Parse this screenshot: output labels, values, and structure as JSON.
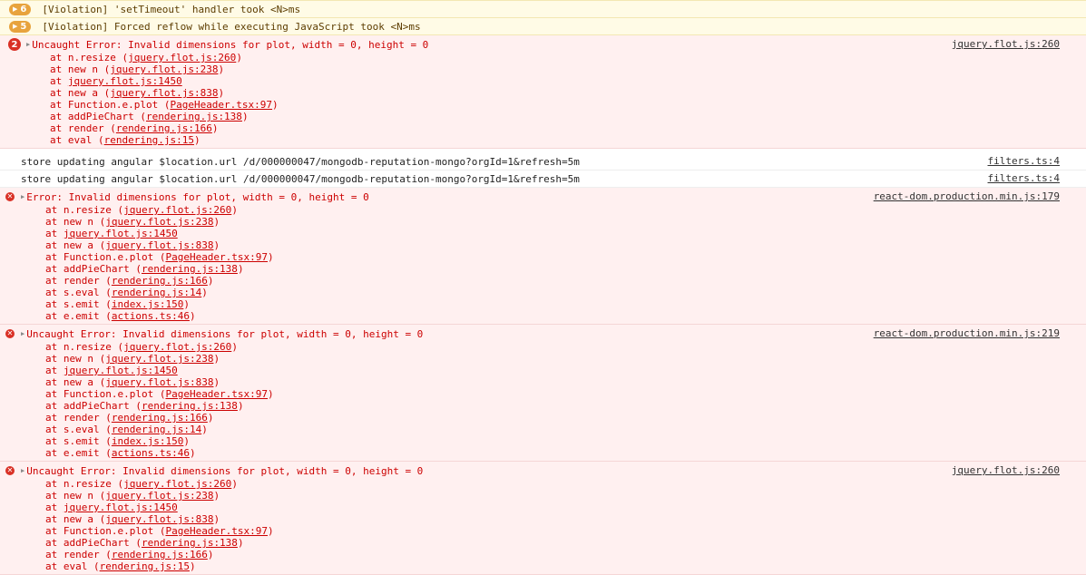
{
  "warnings": [
    {
      "count": "6",
      "message": "[Violation] 'setTimeout' handler took <N>ms"
    },
    {
      "count": "5",
      "message": "[Violation] Forced reflow while executing JavaScript took <N>ms"
    }
  ],
  "entries": [
    {
      "type": "error",
      "badge": "2",
      "message": "Uncaught Error: Invalid dimensions for plot, width = 0, height = 0",
      "source": "jquery.flot.js:260",
      "frames": [
        {
          "prefix": "at n.resize (",
          "link": "jquery.flot.js:260",
          "suffix": ")"
        },
        {
          "prefix": "at new n (",
          "link": "jquery.flot.js:238",
          "suffix": ")"
        },
        {
          "prefix": "at ",
          "link": "jquery.flot.js:1450",
          "suffix": ""
        },
        {
          "prefix": "at new a (",
          "link": "jquery.flot.js:838",
          "suffix": ")"
        },
        {
          "prefix": "at Function.e.plot (",
          "link": "PageHeader.tsx:97",
          "suffix": ")"
        },
        {
          "prefix": "at addPieChart (",
          "link": "rendering.js:138",
          "suffix": ")"
        },
        {
          "prefix": "at render (",
          "link": "rendering.js:166",
          "suffix": ")"
        },
        {
          "prefix": "at eval (",
          "link": "rendering.js:15",
          "suffix": ")"
        }
      ]
    },
    {
      "type": "log",
      "message": "store updating angular $location.url /d/000000047/mongodb-reputation-mongo?orgId=1&refresh=5m",
      "source": "filters.ts:4"
    },
    {
      "type": "log",
      "message": "store updating angular $location.url /d/000000047/mongodb-reputation-mongo?orgId=1&refresh=5m",
      "source": "filters.ts:4"
    },
    {
      "type": "error",
      "message": "Error: Invalid dimensions for plot, width = 0, height = 0",
      "source": "react-dom.production.min.js:179",
      "frames": [
        {
          "prefix": "at n.resize (",
          "link": "jquery.flot.js:260",
          "suffix": ")"
        },
        {
          "prefix": "at new n (",
          "link": "jquery.flot.js:238",
          "suffix": ")"
        },
        {
          "prefix": "at ",
          "link": "jquery.flot.js:1450",
          "suffix": ""
        },
        {
          "prefix": "at new a (",
          "link": "jquery.flot.js:838",
          "suffix": ")"
        },
        {
          "prefix": "at Function.e.plot (",
          "link": "PageHeader.tsx:97",
          "suffix": ")"
        },
        {
          "prefix": "at addPieChart (",
          "link": "rendering.js:138",
          "suffix": ")"
        },
        {
          "prefix": "at render (",
          "link": "rendering.js:166",
          "suffix": ")"
        },
        {
          "prefix": "at s.eval (",
          "link": "rendering.js:14",
          "suffix": ")"
        },
        {
          "prefix": "at s.emit (",
          "link": "index.js:150",
          "suffix": ")"
        },
        {
          "prefix": "at e.emit (",
          "link": "actions.ts:46",
          "suffix": ")"
        }
      ]
    },
    {
      "type": "error",
      "message": "Uncaught Error: Invalid dimensions for plot, width = 0, height = 0",
      "source": "react-dom.production.min.js:219",
      "frames": [
        {
          "prefix": "at n.resize (",
          "link": "jquery.flot.js:260",
          "suffix": ")"
        },
        {
          "prefix": "at new n (",
          "link": "jquery.flot.js:238",
          "suffix": ")"
        },
        {
          "prefix": "at ",
          "link": "jquery.flot.js:1450",
          "suffix": ""
        },
        {
          "prefix": "at new a (",
          "link": "jquery.flot.js:838",
          "suffix": ")"
        },
        {
          "prefix": "at Function.e.plot (",
          "link": "PageHeader.tsx:97",
          "suffix": ")"
        },
        {
          "prefix": "at addPieChart (",
          "link": "rendering.js:138",
          "suffix": ")"
        },
        {
          "prefix": "at render (",
          "link": "rendering.js:166",
          "suffix": ")"
        },
        {
          "prefix": "at s.eval (",
          "link": "rendering.js:14",
          "suffix": ")"
        },
        {
          "prefix": "at s.emit (",
          "link": "index.js:150",
          "suffix": ")"
        },
        {
          "prefix": "at e.emit (",
          "link": "actions.ts:46",
          "suffix": ")"
        }
      ]
    },
    {
      "type": "error",
      "message": "Uncaught Error: Invalid dimensions for plot, width = 0, height = 0",
      "source": "jquery.flot.js:260",
      "frames": [
        {
          "prefix": "at n.resize (",
          "link": "jquery.flot.js:260",
          "suffix": ")"
        },
        {
          "prefix": "at new n (",
          "link": "jquery.flot.js:238",
          "suffix": ")"
        },
        {
          "prefix": "at ",
          "link": "jquery.flot.js:1450",
          "suffix": ""
        },
        {
          "prefix": "at new a (",
          "link": "jquery.flot.js:838",
          "suffix": ")"
        },
        {
          "prefix": "at Function.e.plot (",
          "link": "PageHeader.tsx:97",
          "suffix": ")"
        },
        {
          "prefix": "at addPieChart (",
          "link": "rendering.js:138",
          "suffix": ")"
        },
        {
          "prefix": "at render (",
          "link": "rendering.js:166",
          "suffix": ")"
        },
        {
          "prefix": "at eval (",
          "link": "rendering.js:15",
          "suffix": ")"
        }
      ]
    }
  ]
}
